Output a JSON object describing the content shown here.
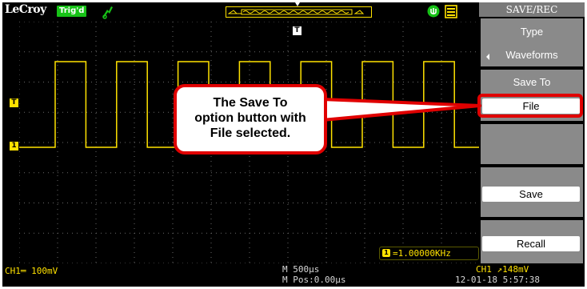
{
  "topbar": {
    "brand": "LeCroy",
    "trigger_status": "Trig'd"
  },
  "menu": {
    "title": "SAVE/REC",
    "type_label": "Type",
    "type_value": "Waveforms",
    "saveto_label": "Save To",
    "saveto_value": "File",
    "save_button": "Save",
    "recall_button": "Recall"
  },
  "markers": {
    "trigger_level": "T",
    "channel1": "1",
    "trigger_position": "T"
  },
  "frequency": {
    "icon": "1",
    "readout": "=1.00000KHz"
  },
  "status": {
    "ch1_scale": "CH1═ 100mV",
    "timebase": "M 500μs",
    "position": "M Pos:0.00μs",
    "trigger_info": "CH1 ↗148mV",
    "datetime": "12-01-18 5:57:38"
  },
  "callout": {
    "text_line1": "The Save To",
    "text_line2": "option button with",
    "text_line3": "File selected."
  },
  "colors": {
    "trace": "#ffe200",
    "trig_badge": "#17c217",
    "callout_border": "#e00000"
  }
}
